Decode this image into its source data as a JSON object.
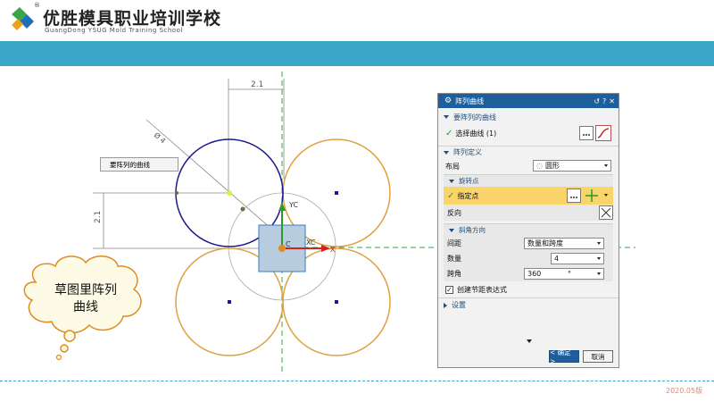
{
  "school": {
    "name_cn": "优胜模具职业培训学校",
    "name_en": "GuangDong YSUG Mold Training School",
    "registered": "®"
  },
  "colors": {
    "banner": "#3ba5c8",
    "dialog_title": "#1c5f9c",
    "highlight": "#f9d46a",
    "arc": "#e0a040",
    "circle": "#1a1a8c"
  },
  "sketch": {
    "callout_label": "要阵列的曲线",
    "dim_top": "2.1",
    "dim_left": "2.1",
    "dim_diameter": "Ø 4",
    "axis_y": "YC",
    "axis_x": "XC",
    "origin_c1": "C",
    "origin_c2": "C",
    "axis_x_end": "X"
  },
  "bubble": {
    "line1": "草图里阵列",
    "line2": "曲线"
  },
  "dialog": {
    "title": "阵列曲线",
    "title_icons": [
      "refresh-icon",
      "help-icon",
      "close-icon"
    ],
    "title_refresh": "↺",
    "title_help": "?",
    "title_close": "✕",
    "sec_curves": "要阵列的曲线",
    "select_curve": "选择曲线 (1)",
    "sec_define": "阵列定义",
    "layout_label": "布局",
    "layout_value": "圆形",
    "sub_rotate": "旋转点",
    "point_label": "指定点",
    "reverse_label": "反向",
    "sub_angle": "斜角方向",
    "spacing_label": "间距",
    "spacing_value": "数量和跨度",
    "count_label": "数量",
    "count_value": "4",
    "span_label": "跨角",
    "span_value": "360",
    "span_unit": "°",
    "checkbox_label": "创建节距表达式",
    "checkbox_checked": true,
    "sec_settings": "设置",
    "ok": "< 确定 >",
    "cancel": "取消"
  },
  "footer": {
    "date": "2020.05版"
  }
}
